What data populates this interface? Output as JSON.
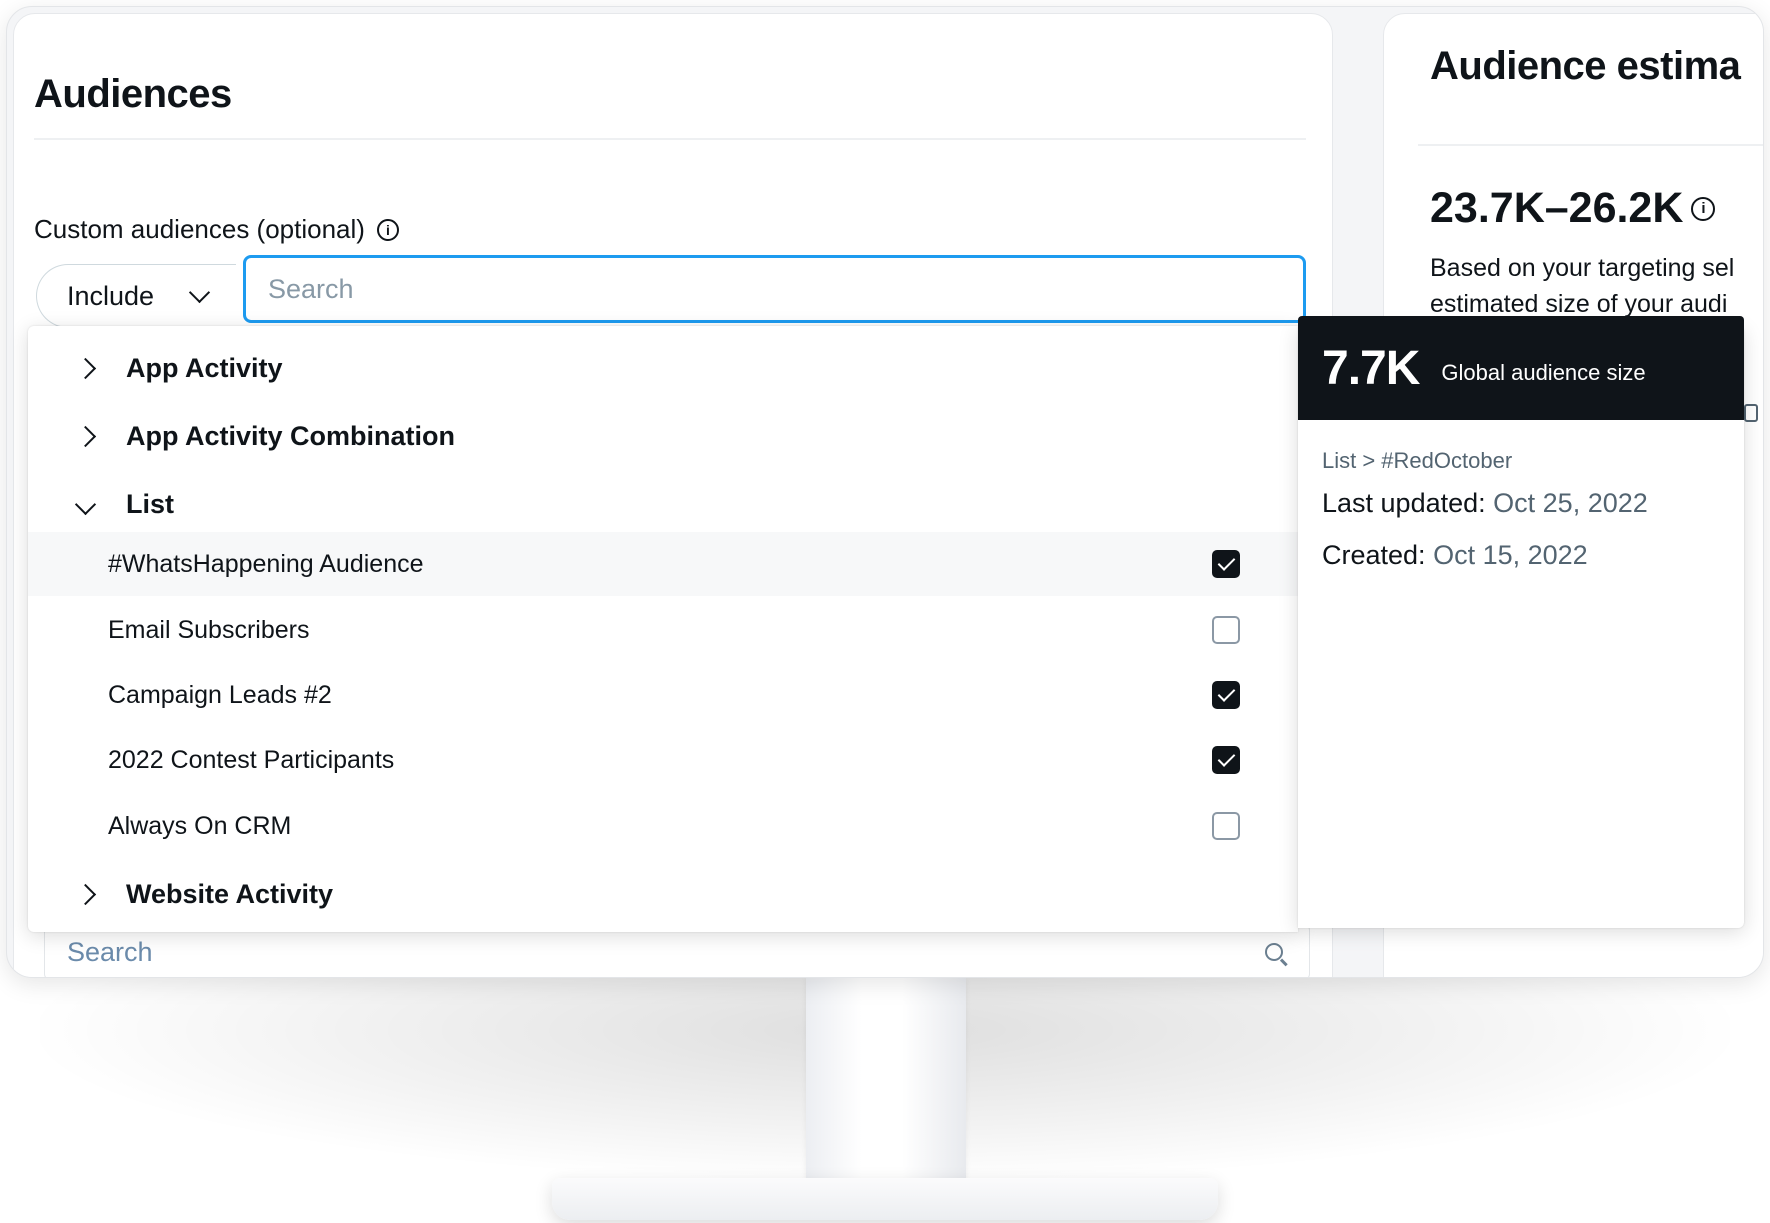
{
  "audiences": {
    "title": "Audiences",
    "custom_label": "Custom audiences (optional)",
    "include_select": "Include",
    "search_placeholder": "Search",
    "lower_search_placeholder": "Search"
  },
  "dropdown": {
    "groups": [
      {
        "label": "App Activity",
        "expanded": false
      },
      {
        "label": "App Activity Combination",
        "expanded": false
      },
      {
        "label": "List",
        "expanded": true
      },
      {
        "label": "Website Activity",
        "expanded": false
      }
    ],
    "list_items": [
      {
        "label": "#WhatsHappening Audience",
        "checked": true
      },
      {
        "label": "Email Subscribers",
        "checked": false
      },
      {
        "label": "Campaign Leads #2",
        "checked": true
      },
      {
        "label": "2022 Contest Participants",
        "checked": true
      },
      {
        "label": "Always On CRM",
        "checked": false
      }
    ]
  },
  "estimate": {
    "title": "Audience estima",
    "range": "23.7K–26.2K",
    "desc_line1": "Based on your targeting sel",
    "desc_line2": "estimated size of your audi"
  },
  "detail": {
    "size": "7.7K",
    "size_label": "Global audience size",
    "breadcrumb": "List > #RedOctober",
    "last_updated_label": "Last updated:",
    "last_updated_value": "Oct 25, 2022",
    "created_label": "Created:",
    "created_value": "Oct 15, 2022"
  },
  "colors": {
    "accent": "#1d9bf0",
    "text": "#0f1419",
    "secondary": "#536471"
  },
  "icons": {
    "info": "info-icon",
    "chevron": "chevron-icon",
    "search": "search-icon"
  }
}
